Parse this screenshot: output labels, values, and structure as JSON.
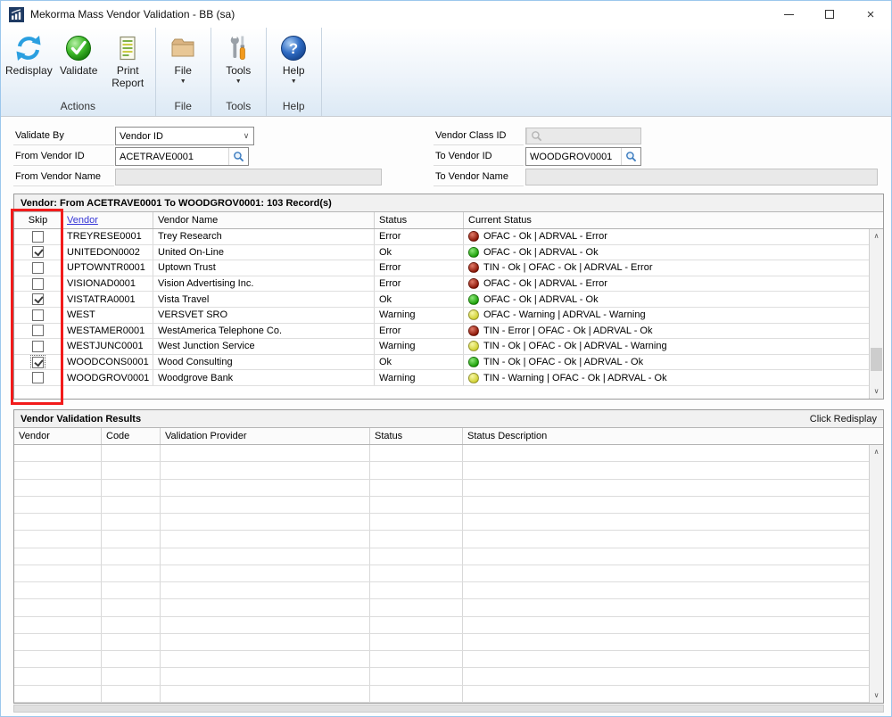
{
  "window": {
    "title": "Mekorma Mass Vendor Validation  -  BB (sa)"
  },
  "icons": {
    "close_glyph": "×",
    "dropdown_glyph": "▼",
    "combo_chevron_glyph": "∨",
    "scroll_up_glyph": "∧",
    "scroll_down_glyph": "∨"
  },
  "toolbar": {
    "groups": [
      {
        "label": "Actions",
        "buttons": [
          {
            "label": "Redisplay",
            "icon": "refresh-icon"
          },
          {
            "label": "Validate",
            "icon": "validate-check-icon"
          },
          {
            "label": "Print\nReport",
            "icon": "print-report-icon"
          }
        ]
      },
      {
        "label": "File",
        "buttons": [
          {
            "label": "File",
            "icon": "folder-icon"
          }
        ]
      },
      {
        "label": "Tools",
        "buttons": [
          {
            "label": "Tools",
            "icon": "tools-icon"
          }
        ]
      },
      {
        "label": "Help",
        "buttons": [
          {
            "label": "Help",
            "icon": "help-icon"
          }
        ]
      }
    ]
  },
  "form": {
    "validate_by": {
      "label": "Validate By",
      "value": "Vendor ID"
    },
    "from_vendor_id": {
      "label": "From Vendor ID",
      "value": "ACETRAVE0001"
    },
    "from_vendor_name": {
      "label": "From Vendor Name",
      "value": ""
    },
    "vendor_class_id": {
      "label": "Vendor Class ID",
      "value": ""
    },
    "to_vendor_id": {
      "label": "To Vendor ID",
      "value": "WOODGROV0001"
    },
    "to_vendor_name": {
      "label": "To Vendor Name",
      "value": ""
    }
  },
  "vendor_table": {
    "title": "Vendor: From ACETRAVE0001 To WOODGROV0001: 103 Record(s)",
    "columns": [
      "Skip",
      "Vendor",
      "Vendor Name",
      "Status",
      "Current Status"
    ],
    "rows": [
      {
        "skip": false,
        "focused": false,
        "vendor": "TREYRESE0001",
        "name": "Trey Research",
        "status": "Error",
        "light": "red",
        "current": "OFAC - Ok | ADRVAL - Error"
      },
      {
        "skip": true,
        "focused": false,
        "vendor": "UNITEDON0002",
        "name": "United On-Line",
        "status": "Ok",
        "light": "green",
        "current": "OFAC - Ok | ADRVAL - Ok"
      },
      {
        "skip": false,
        "focused": false,
        "vendor": "UPTOWNTR0001",
        "name": "Uptown Trust",
        "status": "Error",
        "light": "red",
        "current": "TIN - Ok | OFAC - Ok | ADRVAL - Error"
      },
      {
        "skip": false,
        "focused": false,
        "vendor": "VISIONAD0001",
        "name": "Vision Advertising Inc.",
        "status": "Error",
        "light": "red",
        "current": "OFAC - Ok | ADRVAL - Error"
      },
      {
        "skip": true,
        "focused": false,
        "vendor": "VISTATRA0001",
        "name": "Vista Travel",
        "status": "Ok",
        "light": "green",
        "current": "OFAC - Ok | ADRVAL - Ok"
      },
      {
        "skip": false,
        "focused": false,
        "vendor": "WEST",
        "name": "VERSVET SRO",
        "status": "Warning",
        "light": "yellow",
        "current": "OFAC - Warning | ADRVAL - Warning"
      },
      {
        "skip": false,
        "focused": false,
        "vendor": "WESTAMER0001",
        "name": "WestAmerica Telephone Co.",
        "status": "Error",
        "light": "red",
        "current": "TIN - Error | OFAC - Ok | ADRVAL - Ok"
      },
      {
        "skip": false,
        "focused": false,
        "vendor": "WESTJUNC0001",
        "name": "West Junction Service",
        "status": "Warning",
        "light": "yellow",
        "current": "TIN - Ok | OFAC - Ok | ADRVAL - Warning"
      },
      {
        "skip": true,
        "focused": true,
        "vendor": "WOODCONS0001",
        "name": "Wood Consulting",
        "status": "Ok",
        "light": "green",
        "current": "TIN - Ok | OFAC - Ok | ADRVAL - Ok"
      },
      {
        "skip": false,
        "focused": false,
        "vendor": "WOODGROV0001",
        "name": "Woodgrove Bank",
        "status": "Warning",
        "light": "yellow",
        "current": "TIN - Warning | OFAC - Ok | ADRVAL - Ok"
      }
    ]
  },
  "results_table": {
    "title": "Vendor Validation Results",
    "hint": "Click Redisplay",
    "columns": [
      "Vendor",
      "Code",
      "Validation Provider",
      "Status",
      "Status Description"
    ],
    "rows": [],
    "empty_rows": 15
  },
  "status_colors": {
    "red": [
      "#e07a68",
      "#8a1404"
    ],
    "green": [
      "#8ce878",
      "#189e04"
    ],
    "yellow": [
      "#f7f7a6",
      "#cfcf2e"
    ]
  }
}
